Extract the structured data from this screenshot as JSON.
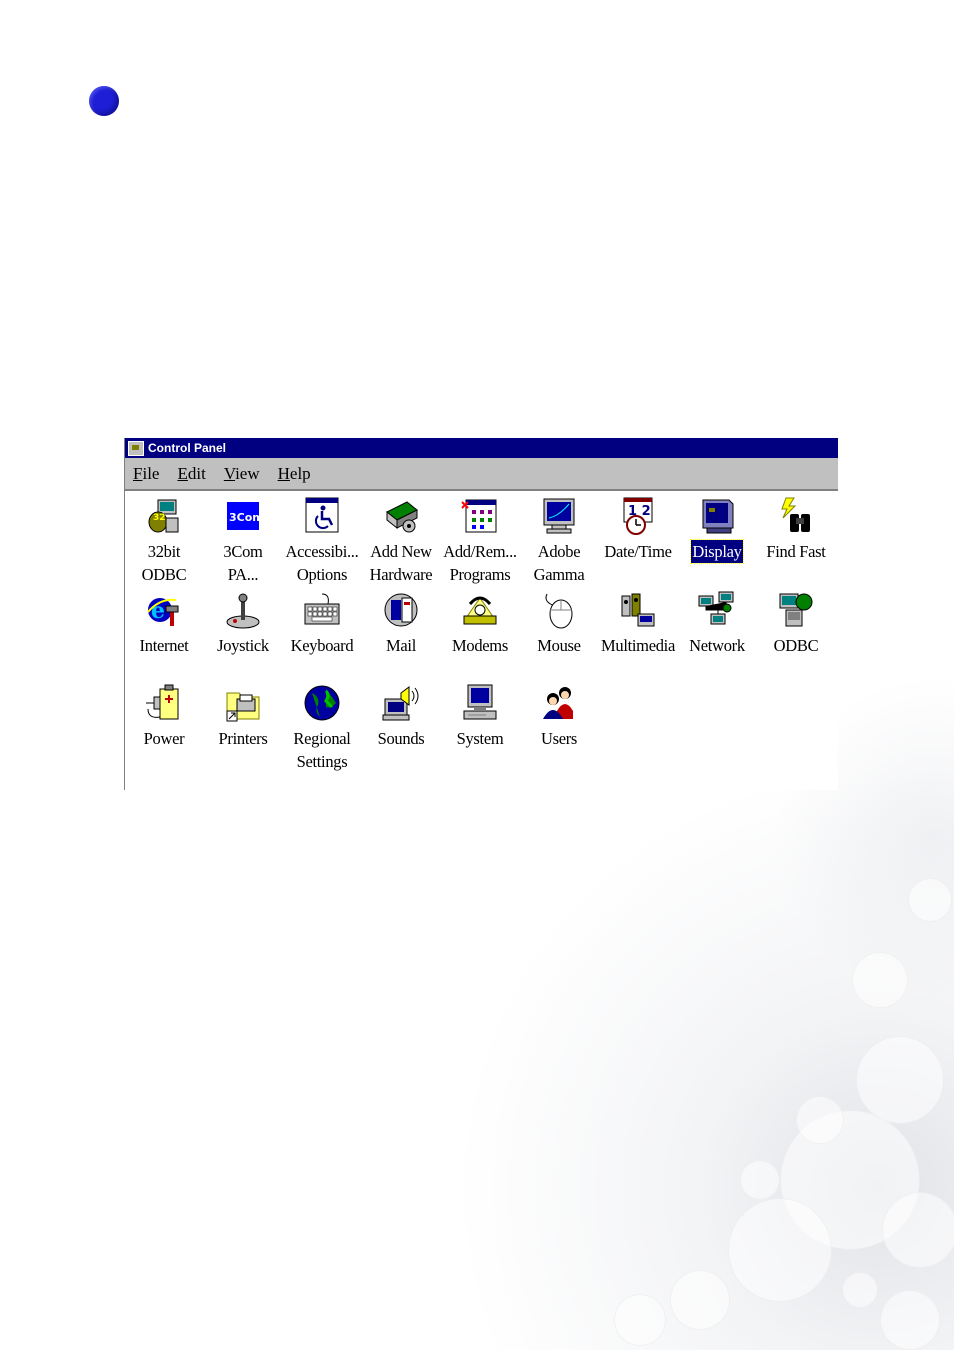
{
  "window": {
    "title": "Control Panel"
  },
  "menu": [
    "File",
    "Edit",
    "View",
    "Help"
  ],
  "icons": [
    {
      "label": "32bit\nODBC",
      "icon": "odbc-32bit-icon"
    },
    {
      "label": "3Com\nPA...",
      "icon": "3com-icon",
      "glyph_text": "3Com"
    },
    {
      "label": "Accessibi...\nOptions",
      "icon": "accessibility-icon"
    },
    {
      "label": "Add New\nHardware",
      "icon": "add-hardware-icon"
    },
    {
      "label": "Add/Rem...\nPrograms",
      "icon": "add-remove-programs-icon"
    },
    {
      "label": "Adobe\nGamma",
      "icon": "adobe-gamma-icon"
    },
    {
      "label": "Date/Time",
      "icon": "date-time-icon",
      "glyph_text": "1 2"
    },
    {
      "label": "Display",
      "icon": "display-icon",
      "selected": true
    },
    {
      "label": "Find Fast",
      "icon": "find-fast-icon"
    },
    {
      "label": "Internet",
      "icon": "internet-icon"
    },
    {
      "label": "Joystick",
      "icon": "joystick-icon"
    },
    {
      "label": "Keyboard",
      "icon": "keyboard-icon"
    },
    {
      "label": "Mail",
      "icon": "mail-icon"
    },
    {
      "label": "Modems",
      "icon": "modems-icon"
    },
    {
      "label": "Mouse",
      "icon": "mouse-icon"
    },
    {
      "label": "Multimedia",
      "icon": "multimedia-icon"
    },
    {
      "label": "Network",
      "icon": "network-icon"
    },
    {
      "label": "ODBC",
      "icon": "odbc-icon"
    },
    {
      "label": "Power",
      "icon": "power-icon"
    },
    {
      "label": "Printers",
      "icon": "printers-icon"
    },
    {
      "label": "Regional\nSettings",
      "icon": "regional-settings-icon"
    },
    {
      "label": "Sounds",
      "icon": "sounds-icon"
    },
    {
      "label": "System",
      "icon": "system-icon"
    },
    {
      "label": "Users",
      "icon": "users-icon"
    }
  ],
  "colors": {
    "titlebar": "#000080",
    "menubar": "#c0c0c0",
    "selection": "#000080",
    "bullet": "#1e1ed6"
  }
}
